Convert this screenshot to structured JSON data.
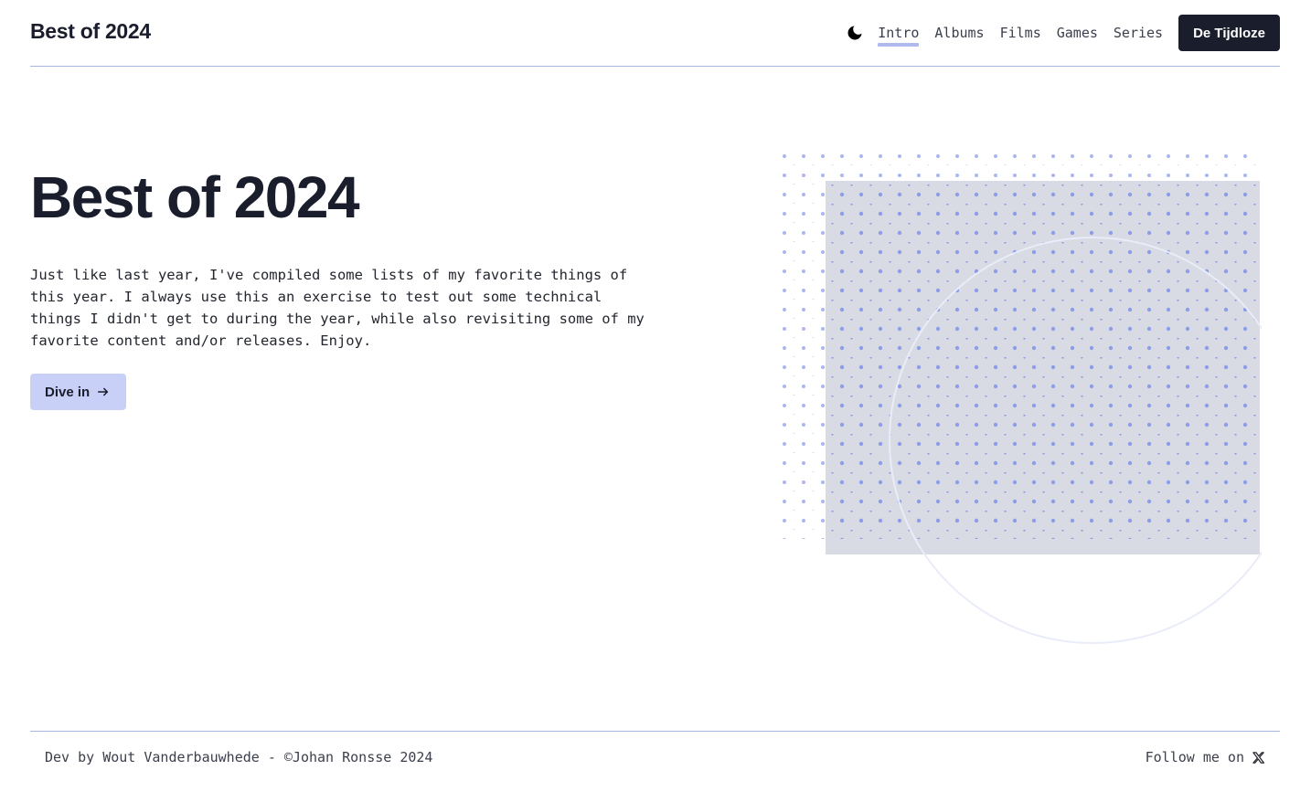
{
  "header": {
    "logo": "Best of 2024",
    "theme_icon": "moon-icon",
    "nav": [
      {
        "label": "Intro",
        "active": true
      },
      {
        "label": "Albums",
        "active": false
      },
      {
        "label": "Films",
        "active": false
      },
      {
        "label": "Games",
        "active": false
      },
      {
        "label": "Series",
        "active": false
      }
    ],
    "cta_label": "De Tijdloze"
  },
  "hero": {
    "title": "Best of 2024",
    "intro": "Just like last year, I've compiled some lists of my favorite things of this year. I always use this an exercise to test out some technical things I didn't get to during the year, while also revisiting some of my favorite content and/or releases. Enjoy.",
    "button_label": "Dive in",
    "button_icon": "arrow-right-icon"
  },
  "footer": {
    "credits": "Dev by Wout Vanderbauwhede - ©Johan Ronsse 2024",
    "follow_label": "Follow me on",
    "follow_icon": "x-logo-icon"
  },
  "colors": {
    "accent": "#aeb9ee",
    "dark": "#1a1d2b",
    "button_light": "#c8d0f7",
    "panel": "#d8dbe3",
    "dot": "#96a6ec"
  }
}
